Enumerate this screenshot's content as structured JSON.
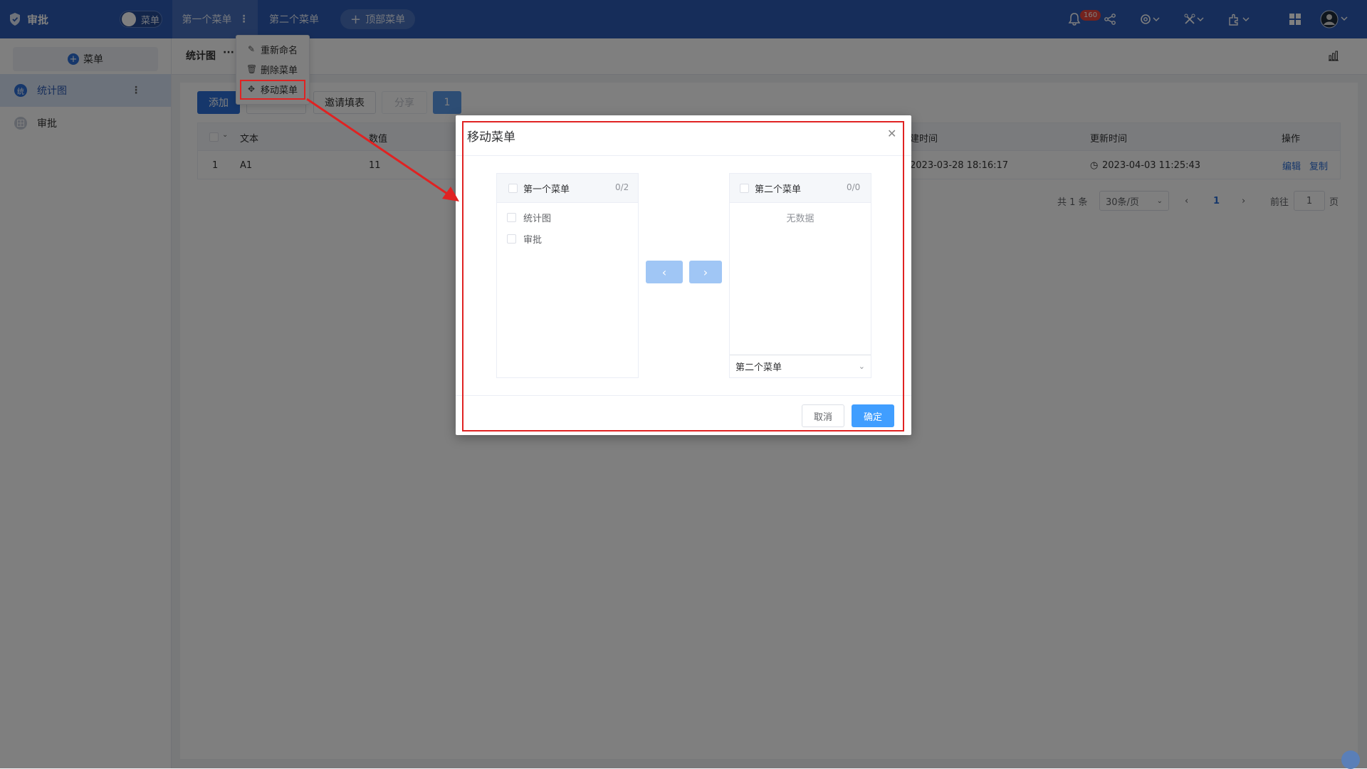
{
  "topbar": {
    "app_title": "审批",
    "toggle_label": "菜单",
    "tabs": [
      {
        "label": "第一个菜单"
      },
      {
        "label": "第二个菜单"
      }
    ],
    "add_top_menu": "顶部菜单",
    "notification_count": "160"
  },
  "sidebar": {
    "add_label": "菜单",
    "items": [
      {
        "label": "统计图",
        "icon_text": "统"
      },
      {
        "label": "审批"
      }
    ]
  },
  "content": {
    "page_title": "统计图",
    "page_title_more": "···",
    "toolbar": {
      "add": "添加",
      "invite": "邀请填表",
      "share": "分享",
      "count": "1"
    },
    "table": {
      "headers": [
        "文本",
        "数值",
        "建时间",
        "更新时间",
        "操作"
      ],
      "rows": [
        {
          "index": "1",
          "text": "A1",
          "value": "11",
          "created": "2023-03-28 18:16:17",
          "updated": "2023-04-03 11:25:43"
        }
      ],
      "actions": {
        "edit": "编辑",
        "copy": "复制"
      }
    },
    "pagination": {
      "total": "共 1 条",
      "page_size": "30条/页",
      "current": "1",
      "goto_prefix": "前往",
      "goto_value": "1",
      "goto_suffix": "页"
    }
  },
  "dropdown": {
    "items": [
      {
        "label": "重新命名"
      },
      {
        "label": "删除菜单"
      },
      {
        "label": "移动菜单"
      }
    ]
  },
  "modal": {
    "title": "移动菜单",
    "left_panel": {
      "title": "第一个菜单",
      "count": "0/2",
      "items": [
        "统计图",
        "审批"
      ]
    },
    "right_panel": {
      "title": "第二个菜单",
      "count": "0/0",
      "empty_text": "无数据",
      "select_value": "第二个菜单"
    },
    "cancel": "取消",
    "confirm": "确定"
  },
  "colors": {
    "topbar": "#2d5bb4",
    "primary": "#409eff",
    "highlight": "#e02222"
  }
}
